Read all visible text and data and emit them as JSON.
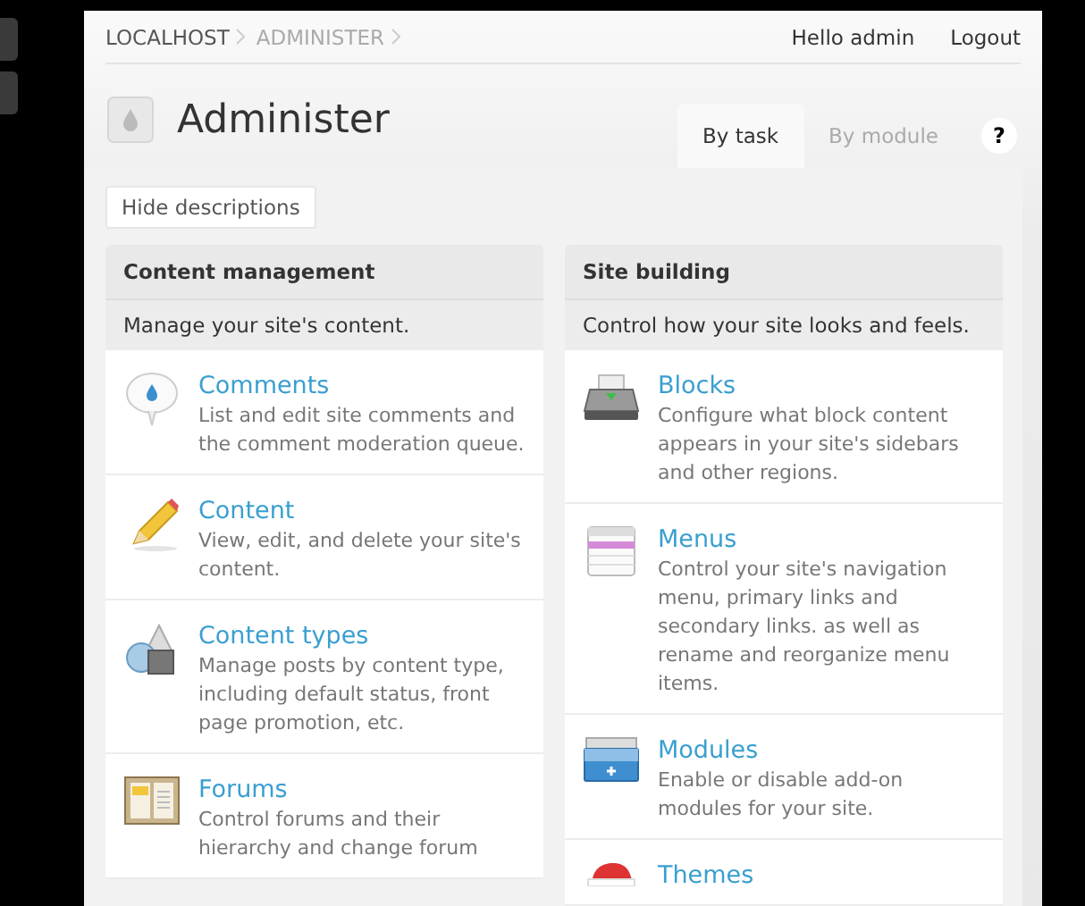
{
  "breadcrumb": [
    {
      "label": "LOCALHOST",
      "selected": false
    },
    {
      "label": "ADMINISTER",
      "selected": true
    }
  ],
  "user_menu": [
    "Hello admin",
    "Logout"
  ],
  "page_title": "Administer",
  "tabs": [
    {
      "label": "By task",
      "selected": true
    },
    {
      "label": "By module",
      "selected": false
    }
  ],
  "help": "?",
  "hide_descriptions_button": "Hide descriptions",
  "sections": [
    {
      "title": "Content management",
      "description": "Manage your site's content.",
      "items": [
        {
          "kind": "comment",
          "title": "Comments",
          "description": "List and edit site comments and the comment moderation queue."
        },
        {
          "kind": "pencil",
          "title": "Content",
          "description": "View, edit, and delete your site's content."
        },
        {
          "kind": "shapes",
          "title": "Content types",
          "description": "Manage posts by content type, including default status, front page promotion, etc."
        },
        {
          "kind": "board",
          "title": "Forums",
          "description": "Control forums and their hierarchy and change forum"
        }
      ]
    },
    {
      "title": "Site building",
      "description": "Control how your site looks and feels.",
      "items": [
        {
          "kind": "tray",
          "title": "Blocks",
          "description": "Configure what block content appears in your site's sidebars and other regions."
        },
        {
          "kind": "menu",
          "title": "Menus",
          "description": "Control your site's navigation menu, primary links and secondary links. as well as rename and reorganize menu items."
        },
        {
          "kind": "toolbox",
          "title": "Modules",
          "description": "Enable or disable add-on modules for your site."
        },
        {
          "kind": "hat",
          "title": "Themes"
        }
      ]
    }
  ]
}
